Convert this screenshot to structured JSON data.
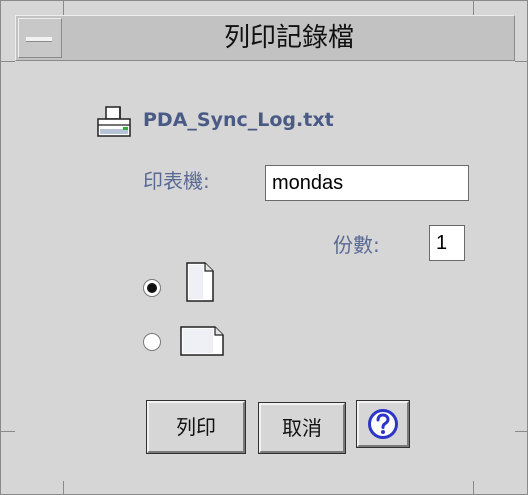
{
  "window": {
    "title": "列印記錄檔"
  },
  "file": {
    "name": "PDA_Sync_Log.txt",
    "icon": "printer-icon"
  },
  "printer": {
    "label": "印表機:",
    "value": "mondas"
  },
  "copies": {
    "label": "份數:",
    "value": "1"
  },
  "orientation": {
    "options": [
      {
        "icon": "portrait-page-icon",
        "selected": true
      },
      {
        "icon": "landscape-page-icon",
        "selected": false
      }
    ]
  },
  "buttons": {
    "print_label": "列印",
    "cancel_label": "取消",
    "help_icon": "help-icon"
  },
  "colors": {
    "label_blue": "#5a6a96",
    "filename_blue": "#4a5a86",
    "help_blue": "#2b35c8",
    "background": "#d6d6d6"
  }
}
